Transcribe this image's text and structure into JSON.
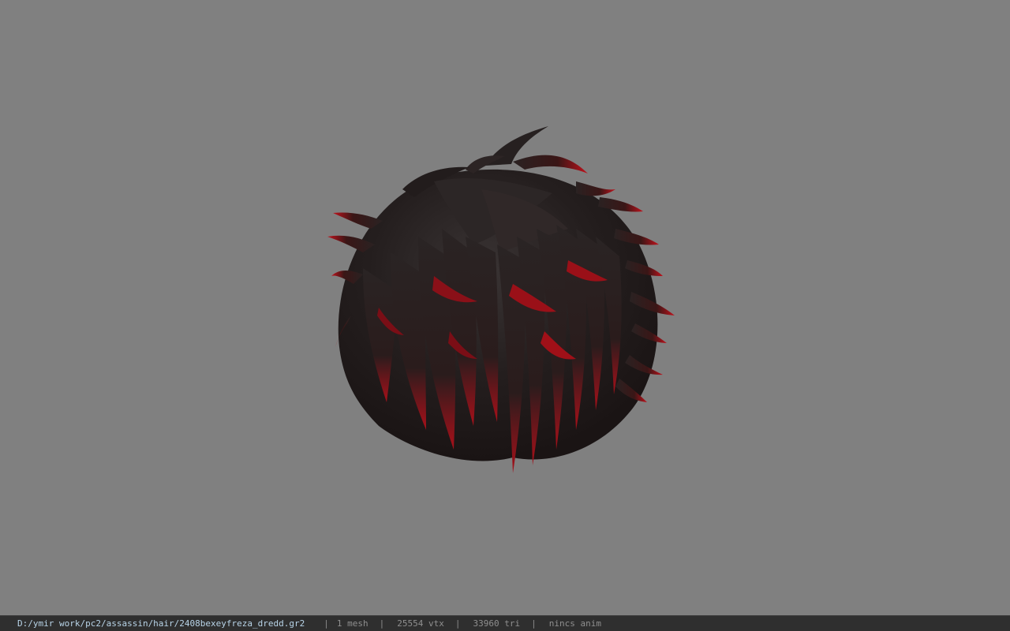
{
  "viewport": {
    "model_icon": "hair-mesh",
    "background_color": "#808080",
    "hair_base_color": "#1e1a1a",
    "hair_tip_color": "#b0101a"
  },
  "statusbar": {
    "file_path": "D:/ymir work/pc2/assassin/hair/2408bexeyfreza_dredd.gr2",
    "separator": "|",
    "mesh_count": "1 mesh",
    "vertex_count": "25554 vtx",
    "triangle_count": "33960 tri",
    "anim_status": "nincs anim"
  }
}
